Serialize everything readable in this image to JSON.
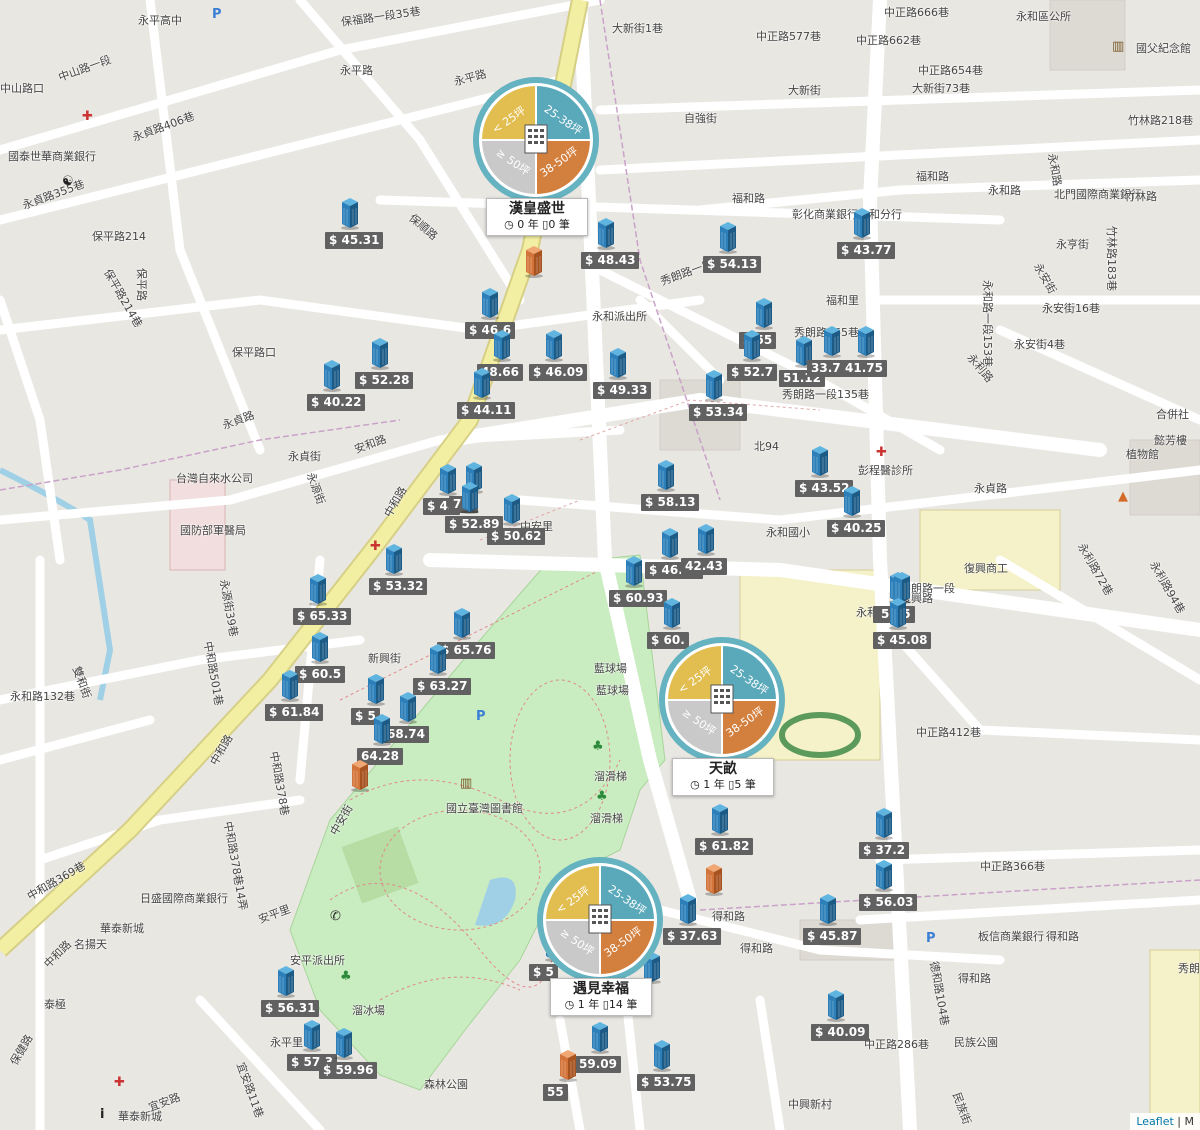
{
  "map": {
    "attribution_link": "Leaflet",
    "attribution_sep": "|",
    "attribution_rest": "M"
  },
  "clusters": [
    {
      "name": "漢皇盛世",
      "age": "0 年",
      "count": "0 筆",
      "seg_lt25": "< 25坪",
      "seg_25_38": "25-38坪",
      "seg_38_50": "38-50坪",
      "seg_ge50": "≥ 50坪"
    },
    {
      "name": "天畝",
      "age": "1 年",
      "count": "5 筆",
      "seg_lt25": "< 25坪",
      "seg_25_38": "25-38坪",
      "seg_38_50": "38-50坪",
      "seg_ge50": "≥ 50坪"
    },
    {
      "name": "遇見幸福",
      "age": "1 年",
      "count": "14 筆",
      "seg_lt25": "< 25坪",
      "seg_25_38": "25-38坪",
      "seg_38_50": "38-50坪",
      "seg_ge50": "≥ 50坪"
    }
  ],
  "markers": [
    {
      "price": "$ 45.31"
    },
    {
      "price": "$ 48.43"
    },
    {
      "price": "$ 54.13"
    },
    {
      "price": "$ 43.77"
    },
    {
      "price": "$ 46.6"
    },
    {
      "price": "48.66"
    },
    {
      "price": "$ 46.09"
    },
    {
      "price": "$ 52.28"
    },
    {
      "price": "$ 40.22"
    },
    {
      "price": "$ 44.11"
    },
    {
      "price": "$ 49.33"
    },
    {
      "price": "$ 53.34"
    },
    {
      "price": "$ 55"
    },
    {
      "price": "$ 52.7"
    },
    {
      "price": "51.12"
    },
    {
      "price": "33.78"
    },
    {
      "price": "41.75"
    },
    {
      "price": "$ 43.52"
    },
    {
      "price": "$ 40.25"
    },
    {
      "price": "$ 58.13"
    },
    {
      "price": "$ 45"
    },
    {
      "price": "7.5"
    },
    {
      "price": "$ 52.89"
    },
    {
      "price": "$ 50.62"
    },
    {
      "price": "$ 53.32"
    },
    {
      "price": "$ 46.49"
    },
    {
      "price": "42.43"
    },
    {
      "price": "$ 60.93"
    },
    {
      "price": "$ 60."
    },
    {
      "price": "$ 4"
    },
    {
      "price": "5.35"
    },
    {
      "price": "$ 45.08"
    },
    {
      "price": "$ 65.33"
    },
    {
      "price": "$ 65.76"
    },
    {
      "price": "$ 60.5"
    },
    {
      "price": "$ 63.27"
    },
    {
      "price": "$ 61.84"
    },
    {
      "price": "$ 5"
    },
    {
      "price": "68.74"
    },
    {
      "price": "64.28"
    },
    {
      "price": "$ 61.82"
    },
    {
      "price": "$ 37.2"
    },
    {
      "price": "$ 56.03"
    },
    {
      "price": "$ 37.63"
    },
    {
      "price": "$ 45.87"
    },
    {
      "price": "$ 5"
    },
    {
      "price": "9"
    },
    {
      "price": "$ 56.31"
    },
    {
      "price": "$ 40.09"
    },
    {
      "price": "$ 57.3"
    },
    {
      "price": "$ 59.96"
    },
    {
      "price": "59.09"
    },
    {
      "price": "$ 53.75"
    },
    {
      "price": "55"
    }
  ],
  "labels": [
    {
      "text": "永平高中"
    },
    {
      "text": "保福路一段35巷"
    },
    {
      "text": "永平路"
    },
    {
      "text": "大新街1巷"
    },
    {
      "text": "中正路577巷"
    },
    {
      "text": "中正路662巷"
    },
    {
      "text": "中正路666巷"
    },
    {
      "text": "中正路654巷"
    },
    {
      "text": "大新街73巷"
    },
    {
      "text": "大新街"
    },
    {
      "text": "自強街"
    },
    {
      "text": "竹林路218巷"
    },
    {
      "text": "永和路"
    },
    {
      "text": "永和區公所"
    },
    {
      "text": "國父紀念館"
    },
    {
      "text": "中山路一段"
    },
    {
      "text": "中山路口"
    },
    {
      "text": "國泰世華商業銀行"
    },
    {
      "text": "永貞路406巷"
    },
    {
      "text": "永貞路355巷"
    },
    {
      "text": "保平路214"
    },
    {
      "text": "保平路"
    },
    {
      "text": "保平路214巷"
    },
    {
      "text": "保平路口"
    },
    {
      "text": "永平路"
    },
    {
      "text": "保順路"
    },
    {
      "text": "永貞路"
    },
    {
      "text": "福和路"
    },
    {
      "text": "福和路"
    },
    {
      "text": "永安街"
    },
    {
      "text": "永亨街"
    },
    {
      "text": "永和路"
    },
    {
      "text": "永安街16巷"
    },
    {
      "text": "永安街4巷"
    },
    {
      "text": "北門國際商業銀行"
    },
    {
      "text": "永和路一段153巷"
    },
    {
      "text": "竹林路"
    },
    {
      "text": "竹林路183巷"
    },
    {
      "text": "彰化商業銀行永和分行"
    },
    {
      "text": "福和里"
    },
    {
      "text": "秀朗路一段"
    },
    {
      "text": "永和派出所"
    },
    {
      "text": "秀朗路465巷"
    },
    {
      "text": "秀朗路一段135巷"
    },
    {
      "text": "永利路"
    },
    {
      "text": "合併社"
    },
    {
      "text": "懿芳樓"
    },
    {
      "text": "植物館"
    },
    {
      "text": "彭程醫診所"
    },
    {
      "text": "北94"
    },
    {
      "text": "永貞路"
    },
    {
      "text": "安和路"
    },
    {
      "text": "永源街"
    },
    {
      "text": "永貞街"
    },
    {
      "text": "台灣自來水公司"
    },
    {
      "text": "國防部軍醫局"
    },
    {
      "text": "中和路"
    },
    {
      "text": "中安里"
    },
    {
      "text": "永和國小"
    },
    {
      "text": "復興商工"
    },
    {
      "text": "秀朗路一段"
    },
    {
      "text": "永和里"
    },
    {
      "text": "永利路72巷"
    },
    {
      "text": "永利路94巷"
    },
    {
      "text": "永源街39巷"
    },
    {
      "text": "新興街"
    },
    {
      "text": "中和路501巷"
    },
    {
      "text": "雙和街"
    },
    {
      "text": "永和路132巷"
    },
    {
      "text": "藍球場"
    },
    {
      "text": "藍球場"
    },
    {
      "text": "中正路412巷"
    },
    {
      "text": "國立臺灣圖書館"
    },
    {
      "text": "中和路378巷"
    },
    {
      "text": "溜滑梯"
    },
    {
      "text": "溜滑梯"
    },
    {
      "text": "中和路378巷14弄"
    },
    {
      "text": "日盛國際商業銀行"
    },
    {
      "text": "中正路366巷"
    },
    {
      "text": "中安街"
    },
    {
      "text": "得和路"
    },
    {
      "text": "得和路"
    },
    {
      "text": "得和路"
    },
    {
      "text": "板信商業銀行"
    },
    {
      "text": "中和路369巷"
    },
    {
      "text": "華泰新城"
    },
    {
      "text": "名揚天"
    },
    {
      "text": "安平派出所"
    },
    {
      "text": "溜冰場"
    },
    {
      "text": "泰極"
    },
    {
      "text": "得和路"
    },
    {
      "text": "民族公園"
    },
    {
      "text": "中和路"
    },
    {
      "text": "保健路"
    },
    {
      "text": "宜安路11巷"
    },
    {
      "text": "森林公園"
    },
    {
      "text": "華泰新城"
    },
    {
      "text": "中興新村"
    },
    {
      "text": "宜安路"
    },
    {
      "text": "永平里"
    },
    {
      "text": "安平里"
    },
    {
      "text": "德和路104巷"
    },
    {
      "text": "中正路286巷"
    },
    {
      "text": "民族街"
    },
    {
      "text": "秀朗"
    },
    {
      "text": "中和路"
    },
    {
      "text": "復興路"
    }
  ],
  "colors": {
    "seg_lt25": "#e2bd4f",
    "seg_25_38": "#5aa9bb",
    "seg_38_50": "#d37f3e",
    "seg_ge50": "#c9c9c9",
    "ring": "#65b2c0",
    "building": "#2c7fb8",
    "building_dark": "#1d5b87",
    "building_top": "#5fb4e0",
    "building_alt": "#d3743a",
    "price_bg": "#616161",
    "park": "#c9ecc0",
    "road": "#ffffff",
    "main_road": "#f3efa2",
    "water": "#9fd0e6"
  }
}
